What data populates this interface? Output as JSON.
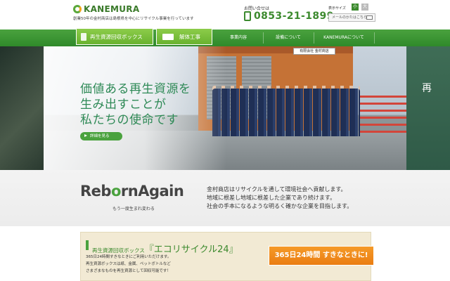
{
  "header": {
    "logo_text": "KANEMURA",
    "tagline": "創業50年の金村商店は島根県を中心にリサイクル事業を行っています",
    "contact_label": "お問い合せは",
    "phone": "0853-21-1899",
    "font_size_label": "表示サイズ",
    "font_size_small": "小",
    "font_size_large": "大",
    "mail_label": "メールのかたはこちら"
  },
  "nav": {
    "recycle_box": "再生資源回収ボックス",
    "demolition": "解体工事",
    "items": [
      "事業内容",
      "設備について",
      "KANEMURAについて"
    ]
  },
  "hero": {
    "headline_lines": [
      "価値ある再生資源を",
      "生み出すことが",
      "私たちの使命です"
    ],
    "detail_button": "詳細を見る",
    "sign_text": "有限会社 金村商店",
    "right_peek": "再"
  },
  "reborn": {
    "title_part1": "Reb",
    "title_o": "o",
    "title_part2": "rnAgain",
    "subtitle": "もう一度生まれ変わる",
    "lines": [
      "金村商店はリサイクルを通して環境社会へ貢献します。",
      "地域に根差し地域に根差した企業であり続けます。",
      "社会の手本になるような明るく確かな企業を目指します。"
    ]
  },
  "recycle_box": {
    "title_small": "再生資源回収ボックス",
    "title_big": "『エコリサイクル24』",
    "body": [
      "365日24時間すきなときにご利用いただけます。",
      "再生資源ボックスは紙、金属、ペットボトルなど",
      "さまざまなものを再生資源として回収可能です！"
    ],
    "badge": "365日24時間 すきなときに!"
  },
  "colors": {
    "brand_green": "#3c8a2e",
    "light_green": "#69b22f",
    "orange": "#ea7d12"
  }
}
